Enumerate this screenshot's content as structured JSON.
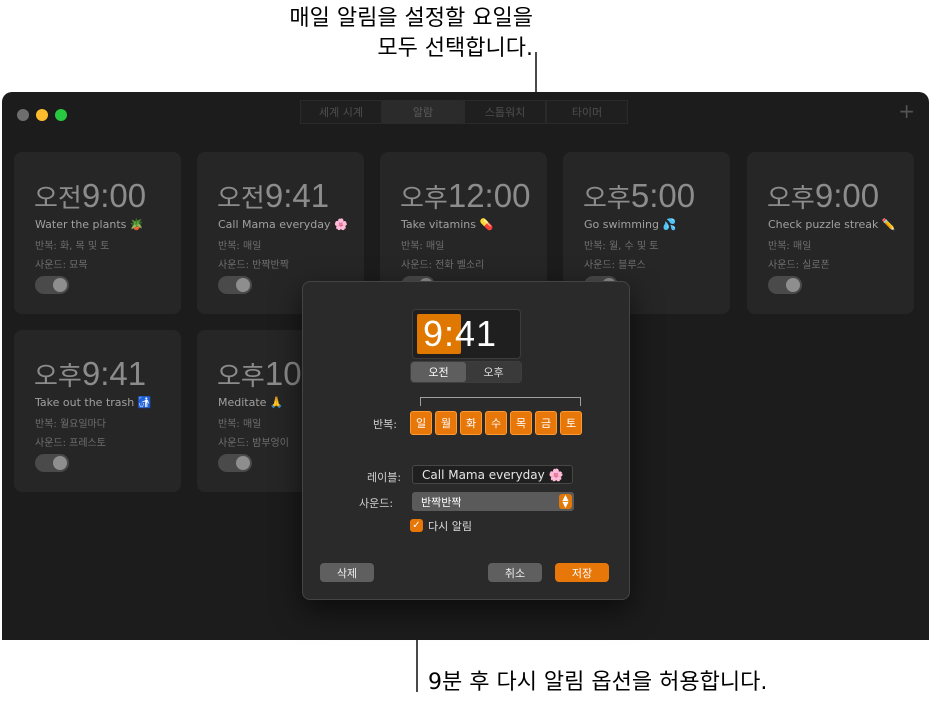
{
  "annotations": {
    "top_line1": "매일 알림을 설정할 요일을",
    "top_line2": "모두 선택합니다.",
    "bottom": "9분 후 다시 알림 옵션을 허용합니다."
  },
  "toolbar": {
    "tabs": [
      "세계 시계",
      "알람",
      "스톱워치",
      "타이머"
    ],
    "active_tab": "알람",
    "add_symbol": "+"
  },
  "alarms": [
    {
      "ampm": "오전",
      "time": "9:00",
      "label": "Water the plants 🪴",
      "repeat": "반복: 화, 목 및 토",
      "sound": "사운드: 묘목"
    },
    {
      "ampm": "오전",
      "time": "9:41",
      "label": "Call Mama everyday 🌸",
      "repeat": "반복: 매일",
      "sound": "사운드: 반짝반짝"
    },
    {
      "ampm": "오후",
      "time": "12:00",
      "label": "Take vitamins 💊",
      "repeat": "반복: 매일",
      "sound": "사운드: 전화 벨소리"
    },
    {
      "ampm": "오후",
      "time": "5:00",
      "label": "Go swimming 💦",
      "repeat": "반복: 월, 수 및 토",
      "sound": "사운드: 블루스"
    },
    {
      "ampm": "오후",
      "time": "9:00",
      "label": "Check puzzle streak ✏️",
      "repeat": "반복: 매일",
      "sound": "사운드: 실로폰"
    },
    {
      "ampm": "오후",
      "time": "9:41",
      "label": "Take out the trash 🚮",
      "repeat": "반복: 월요일마다",
      "sound": "사운드: 프레스토"
    },
    {
      "ampm": "오후",
      "time": "10",
      "label": "Meditate 🙏",
      "repeat": "반복: 매일",
      "sound": "사운드: 밤부엉이"
    }
  ],
  "dialog": {
    "hour": "9",
    "time": "9:41",
    "am": "오전",
    "pm": "오후",
    "selected_period": "오전",
    "repeat_label": "반복:",
    "days": [
      "일",
      "월",
      "화",
      "수",
      "목",
      "금",
      "토"
    ],
    "label_label": "레이블:",
    "label_value": "Call Mama everyday 🌸",
    "sound_label": "사운드:",
    "sound_value": "반짝반짝",
    "snooze_label": "다시 알림",
    "snooze_checked": true,
    "delete": "삭제",
    "cancel": "취소",
    "save": "저장"
  },
  "colors": {
    "accent": "#e8770a",
    "window": "#1c1c1c",
    "card": "#262626"
  }
}
